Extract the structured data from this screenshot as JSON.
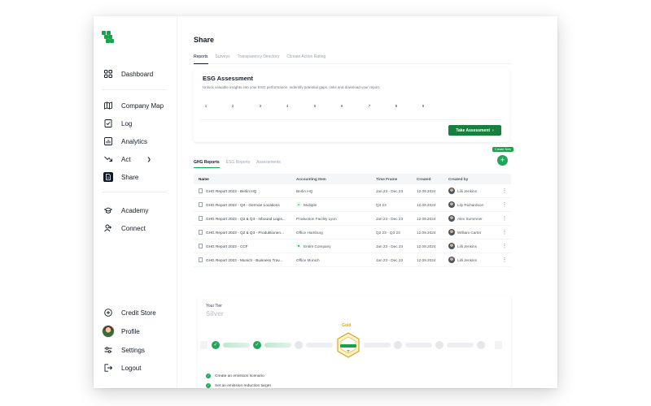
{
  "sidebar": {
    "items": [
      {
        "label": "Dashboard",
        "icon": "grid-icon"
      },
      {
        "label": "Company Map",
        "icon": "map-icon"
      },
      {
        "label": "Log",
        "icon": "log-icon"
      },
      {
        "label": "Analytics",
        "icon": "analytics-icon"
      },
      {
        "label": "Act",
        "icon": "trend-down-icon"
      },
      {
        "label": "Share",
        "icon": "share-doc-icon",
        "active": true
      },
      {
        "label": "Academy",
        "icon": "graduation-cap-icon"
      },
      {
        "label": "Connect",
        "icon": "user-plus-icon"
      }
    ],
    "bottom": [
      {
        "label": "Credit Store",
        "icon": "plus-circle-icon"
      },
      {
        "label": "Profile",
        "icon": "avatar"
      },
      {
        "label": "Settings",
        "icon": "sliders-icon"
      },
      {
        "label": "Logout",
        "icon": "logout-icon"
      }
    ]
  },
  "page": {
    "title": "Share",
    "tabs": [
      "Reports",
      "Surveys",
      "Transparency Directory",
      "Climate Action Rating"
    ]
  },
  "esg": {
    "title": "ESG Assessment",
    "description": "Unlock valuable insights into your ESG performance. Indentify potential gaps, risks and download your report.",
    "steps": [
      "1",
      "2",
      "3",
      "4",
      "5",
      "6",
      "7",
      "8",
      "9"
    ],
    "button": "Take Assessment"
  },
  "reports": {
    "tabs": [
      "GHG Reports",
      "ESG Reports",
      "Assessments"
    ],
    "create_new": "Create New",
    "columns": [
      "Name",
      "Accounting Item",
      "Time Frame",
      "Created",
      "Created by"
    ],
    "rows": [
      {
        "name": "GHG Report 2023 - Berlin HQ",
        "account": "Berlin HQ",
        "account_icon": "",
        "time": "Jan 23 - Dec 23",
        "created": "12.09.2024",
        "by": "Lilli Jenkins"
      },
      {
        "name": "GHG Report 2023 - Q4 - German Locations",
        "account": "Multiple",
        "account_icon": "location-icon",
        "time": "Q4 23",
        "created": "12.09.2024",
        "by": "Lily Richardson"
      },
      {
        "name": "GHG Report 2023 - Q2 & Q3 - Inbound Logis...",
        "account": "Production Facility Lyon",
        "account_icon": "",
        "time": "Jan 23 - Dec 23",
        "created": "12.09.2024",
        "by": "Alex Summner"
      },
      {
        "name": "GHG Report 2023 - Q2 & Q3 - Produktionen...",
        "account": "Office Hamburg",
        "account_icon": "",
        "time": "Q2 23 - Q3 23",
        "created": "12.09.2024",
        "by": "William Carter"
      },
      {
        "name": "GHG Report 2023 - CCF",
        "account": "Entire Company",
        "account_icon": "company-icon",
        "time": "Jan 23 - Dec 23",
        "created": "12.09.2024",
        "by": "Lilli Jenkins"
      },
      {
        "name": "GHG Report 2023 - Munich - Business Trav...",
        "account": "Office Munich",
        "account_icon": "",
        "time": "Jan 23 - Dec 23",
        "created": "12.09.2024",
        "by": "Lilli Jenkins"
      }
    ]
  },
  "tier": {
    "label": "Your Tier",
    "name": "Silver",
    "next": "Gold",
    "tasks": [
      "Create an emission scenario",
      "Set an emission reduction target"
    ]
  },
  "colors": {
    "accent": "#16a34a",
    "button": "#15803d",
    "gold": "#d4a72c"
  }
}
